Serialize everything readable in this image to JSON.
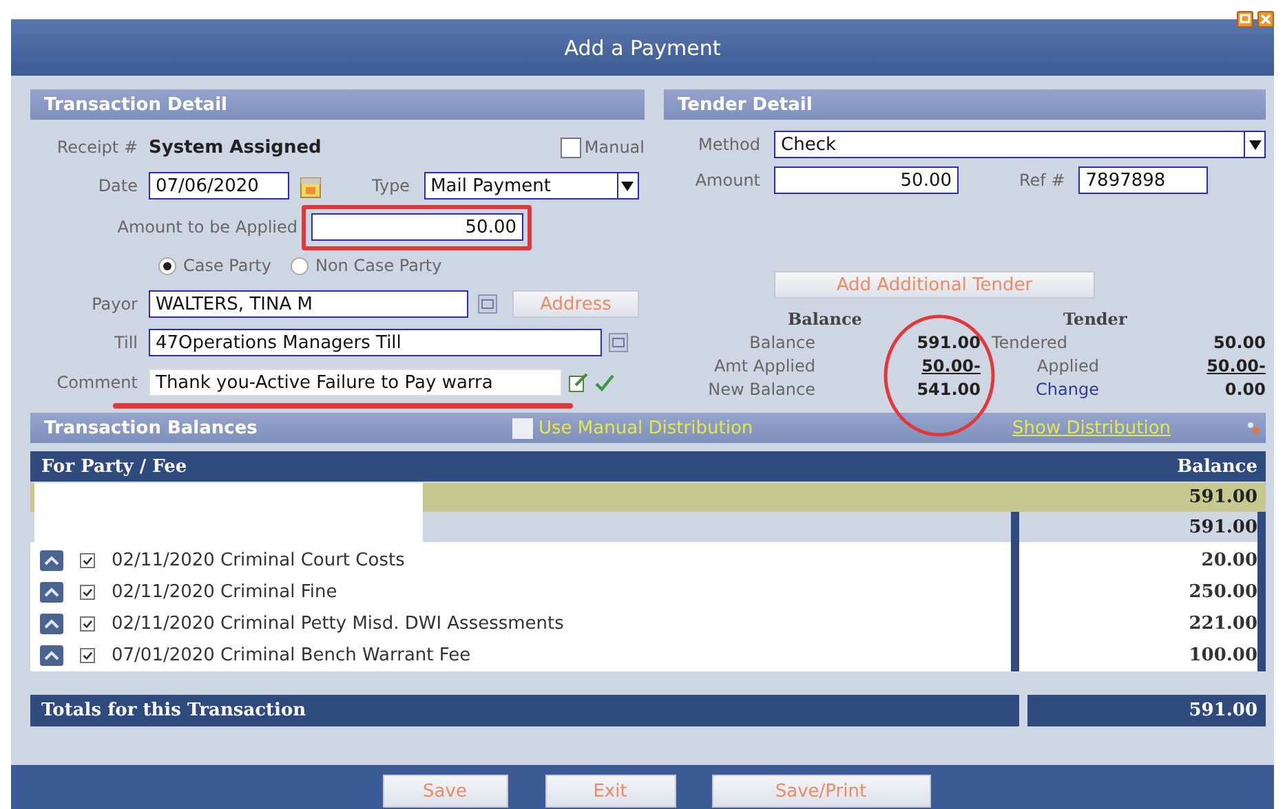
{
  "window": {
    "title": "Add a Payment"
  },
  "transaction_detail": {
    "title": "Transaction Detail",
    "receipt_label": "Receipt #",
    "receipt_value": "System Assigned",
    "manual": {
      "label": "Manual",
      "checked": false
    },
    "date_label": "Date",
    "date": "07/06/2020",
    "type_label": "Type",
    "type": "Mail Payment",
    "amount_label": "Amount to be Applied",
    "amount": "50.00",
    "amount_highlighted": true,
    "party_options": [
      {
        "label": "Case Party",
        "selected": true
      },
      {
        "label": "Non Case Party",
        "selected": false
      }
    ],
    "payor_label": "Payor",
    "payor": "WALTERS, TINA M",
    "address_button": "Address",
    "till_label": "Till",
    "till": "47Operations Managers Till",
    "comment_label": "Comment",
    "comment": "Thank you-Active Failure to Pay warra",
    "comment_underlined": true
  },
  "tender_detail": {
    "title": "Tender Detail",
    "method_label": "Method",
    "method": "Check",
    "amount_label": "Amount",
    "amount": "50.00",
    "ref_label": "Ref #",
    "ref": "7897898",
    "add_tender_button": "Add Additional Tender",
    "balance_heading": "Balance",
    "tender_heading": "Tender",
    "balance_circled": true,
    "balance_rows": [
      {
        "label": "Balance",
        "value": "591.00",
        "underlined": false
      },
      {
        "label": "Amt Applied",
        "value": "50.00-",
        "underlined": true
      },
      {
        "label": "New Balance",
        "value": "541.00",
        "underlined": false
      }
    ],
    "tender_rows": [
      {
        "label": "Tendered",
        "value": "50.00",
        "underlined": false,
        "link": false
      },
      {
        "label": "Applied",
        "value": "50.00-",
        "underlined": true,
        "link": false
      },
      {
        "label": "Change",
        "value": "0.00",
        "underlined": false,
        "link": true
      }
    ]
  },
  "transaction_balances": {
    "title": "Transaction Balances",
    "manual_distribution": {
      "label": "Use Manual Distribution",
      "checked": false
    },
    "show_distribution": "Show Distribution",
    "columns": [
      "For Party / Fee",
      "Balance"
    ],
    "party_balance": "591.00",
    "subtotal": "591.00",
    "fees": [
      {
        "description": "02/11/2020 Criminal Court Costs",
        "checked": true,
        "balance": "20.00"
      },
      {
        "description": "02/11/2020 Criminal Fine",
        "checked": true,
        "balance": "250.00"
      },
      {
        "description": "02/11/2020 Criminal Petty Misd. DWI Assessments",
        "checked": true,
        "balance": "221.00"
      },
      {
        "description": "07/01/2020 Criminal Bench Warrant Fee",
        "checked": true,
        "balance": "100.00"
      }
    ],
    "totals_label": "Totals for this Transaction",
    "total": "591.00"
  },
  "buttons": [
    {
      "label": "Save"
    },
    {
      "label": "Exit"
    },
    {
      "label": "Save/Print"
    }
  ]
}
